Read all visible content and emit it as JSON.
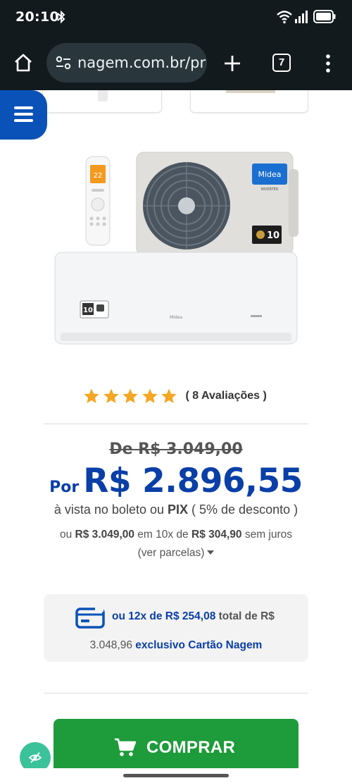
{
  "status_bar": {
    "time": "20:10"
  },
  "browser": {
    "url": "nagem.com.br/pr",
    "tab_count": "7"
  },
  "product": {
    "image_alt": "Ar-condicionado Midea Inverter",
    "brand": "Midea",
    "inverter_label": "INVERTER",
    "warranty_badge": "10"
  },
  "rating": {
    "stars": 5,
    "max_stars": 5,
    "text": "( 8 Avaliações )"
  },
  "pricing": {
    "old_price": "De R$ 3.049,00",
    "prefix": "Por",
    "price": "R$ 2.896,55",
    "pix_pre": "à vista no boleto ou ",
    "pix_bold": "PIX",
    "pix_post": " ( 5% de desconto )",
    "install_pre": "ou ",
    "install_total": "R$ 3.049,00",
    "install_mid": " em 10x de ",
    "install_value": "R$ 304,90",
    "install_post": " sem juros",
    "parcelas_link": "(ver parcelas)"
  },
  "card_offer": {
    "line1_blue": "ou 12x de R$ 254,08",
    "line1_gray": " total de R$",
    "line2_gray": "3.048,96 ",
    "line2_blue": "exclusivo Cartão Nagem"
  },
  "buy": {
    "label": "COMPRAR"
  },
  "colors": {
    "primary_blue": "#0a52b8",
    "price_blue": "#0a3fa8",
    "buy_green": "#1e9b3a",
    "star": "#f5a623",
    "a11y_green": "#3cc29a"
  }
}
